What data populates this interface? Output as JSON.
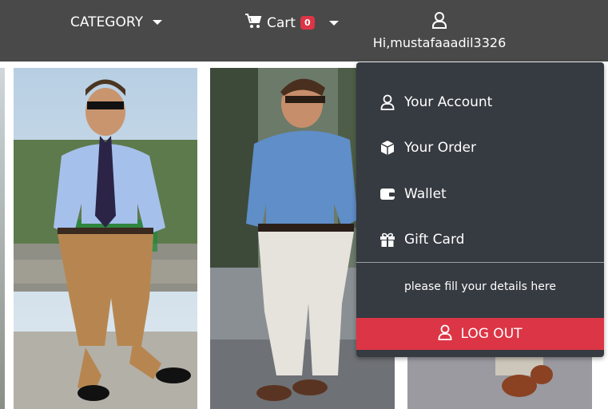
{
  "navbar": {
    "category_label": "CATEGORY",
    "cart_label": "Cart",
    "cart_count": "0",
    "greeting": "Hi,mustafaaadil3326"
  },
  "dropdown": {
    "items": [
      {
        "label": "Your Account",
        "icon": "user-icon"
      },
      {
        "label": "Your Order",
        "icon": "box-icon"
      },
      {
        "label": "Wallet",
        "icon": "wallet-icon"
      },
      {
        "label": "Gift Card",
        "icon": "gift-icon"
      }
    ],
    "note": "please fill your details here",
    "logout_label": "LOG OUT"
  },
  "colors": {
    "navbar_bg": "#494949",
    "dropdown_bg": "#363a41",
    "danger": "#dc3545"
  },
  "products": [
    {
      "image": "man-light-blue-shirt-khaki-pants"
    },
    {
      "image": "man-denim-shirt-white-pants"
    },
    {
      "image": "brown-shoes-partial"
    }
  ]
}
